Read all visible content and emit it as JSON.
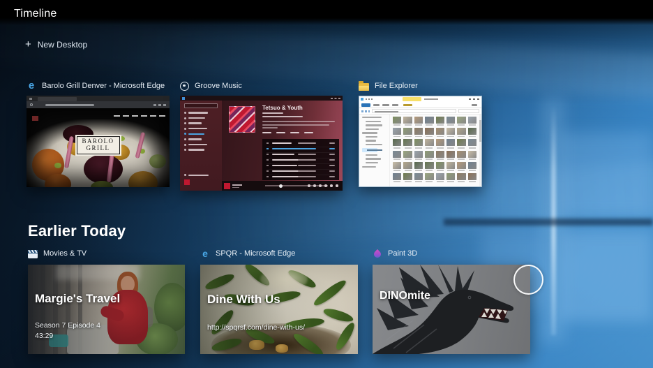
{
  "topbar": {
    "title": "Timeline"
  },
  "toolbar": {
    "new_desktop": "New Desktop",
    "plus": "+"
  },
  "sections": {
    "earlier_today": "Earlier Today"
  },
  "windows": {
    "edge": {
      "title": "Barolo Grill Denver - Microsoft Edge",
      "logo_line1": "BAROLO",
      "logo_line2": "GRILL"
    },
    "groove": {
      "title": "Groove Music",
      "album": "Tetsuo & Youth",
      "tracks": 7,
      "playing_track_index": 1,
      "sidebar_items": 8,
      "selected_sidebar_index": 4
    },
    "explorer": {
      "title": "File Explorer",
      "grid_rows": 6,
      "grid_cols": 8,
      "selected_tree_index": 8,
      "tree_widths": [
        78,
        60,
        66,
        52,
        62,
        48,
        42,
        68,
        60,
        46,
        62,
        50,
        56
      ],
      "palette": [
        "#7d8f5e",
        "#b3a78b",
        "#8a6f55",
        "#9aa4ad",
        "#6e7b4d",
        "#c0b49c",
        "#56684a",
        "#a58e6f",
        "#8e9b74",
        "#7a8a95",
        "#b59a7a",
        "#64754f",
        "#cabfa8",
        "#8d7a62",
        "#99a67f",
        "#70808f"
      ]
    }
  },
  "cards": [
    {
      "app": "Movies & TV",
      "title": "Margie's Travel",
      "line2": "Season 7 Episode 4",
      "line3": "43:29"
    },
    {
      "app": "SPQR - Microsoft Edge",
      "title": "Dine With Us",
      "line2": "http://spqrsf.com/dine-with-us/"
    },
    {
      "app": "Paint 3D",
      "title": "DINOmite"
    }
  ],
  "icons": {
    "edge_glyph": "e"
  },
  "colors": {
    "accent_blue": "#4aa3e0",
    "groove_red": "#c01830",
    "tools_yellow": "#f8e06a"
  }
}
